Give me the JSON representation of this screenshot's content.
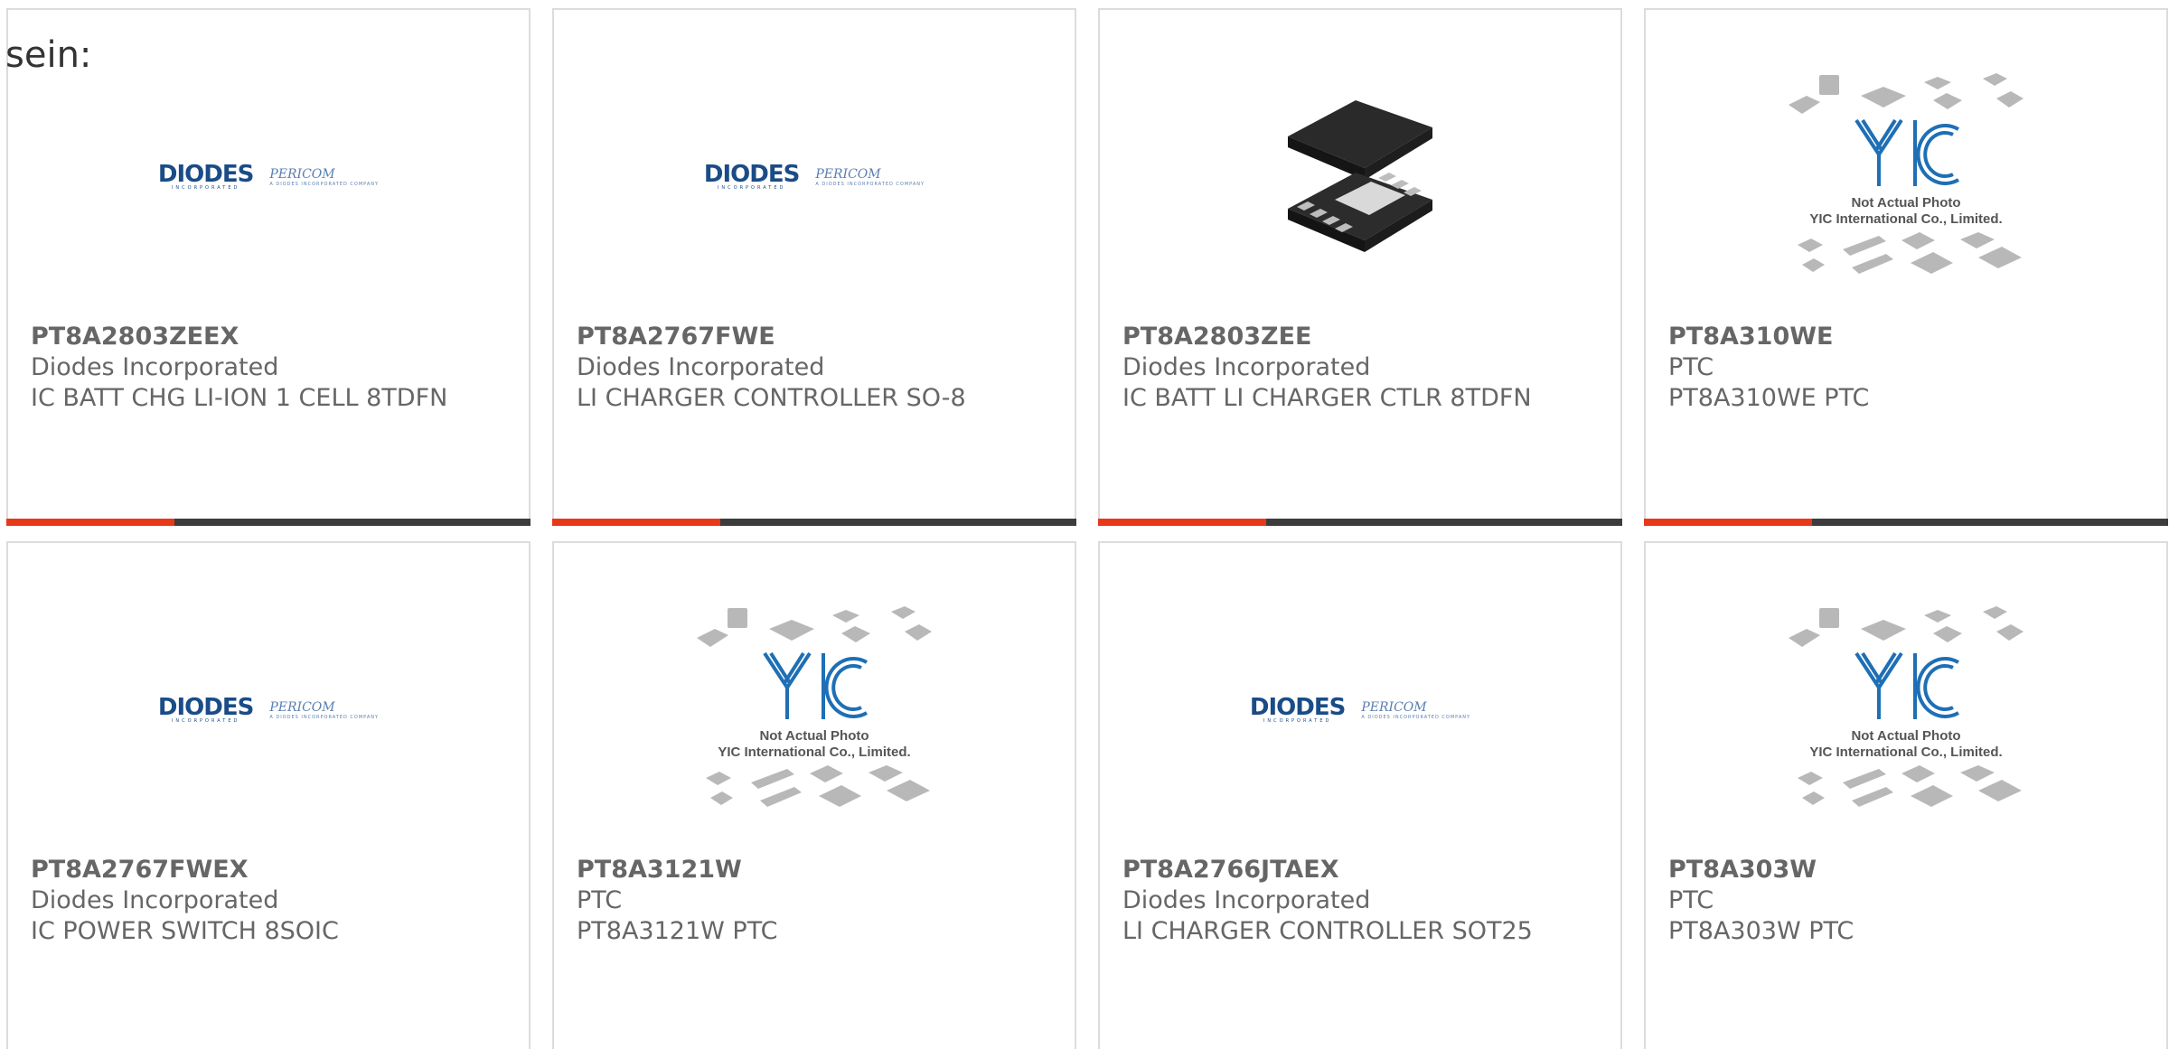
{
  "intro": {
    "text": "sein:"
  },
  "logos": {
    "diodes": "DIODES",
    "diodes_sub": "INCORPORATED",
    "pericom": "PERICOM",
    "pericom_sub": "A DIODES INCORPORATED COMPANY"
  },
  "yic": {
    "line1": "Not Actual Photo",
    "line2": "YIC International Co., Limited."
  },
  "colors": {
    "accent": "#e8381a",
    "bar": "#3c3c3c",
    "text": "#666666",
    "brand_blue": "#1a4c87"
  },
  "products": [
    {
      "part": "PT8A2803ZEEX",
      "manufacturer": "Diodes Incorporated",
      "description": "IC BATT CHG LI-ION 1 CELL 8TDFN",
      "image": "diodes-pericom-logo",
      "progress": 0.32
    },
    {
      "part": "PT8A2767FWE",
      "manufacturer": "Diodes Incorporated",
      "description": "LI CHARGER CONTROLLER SO-8",
      "image": "diodes-pericom-logo",
      "progress": 0.32
    },
    {
      "part": "PT8A2803ZEE",
      "manufacturer": "Diodes Incorporated",
      "description": "IC BATT LI CHARGER CTLR 8TDFN",
      "image": "chip-photo",
      "progress": 0.32
    },
    {
      "part": "PT8A310WE",
      "manufacturer": "PTC",
      "description": "PT8A310WE PTC",
      "image": "yic-placeholder",
      "progress": 0.32
    },
    {
      "part": "PT8A2767FWEX",
      "manufacturer": "Diodes Incorporated",
      "description": "IC POWER SWITCH 8SOIC",
      "image": "diodes-pericom-logo"
    },
    {
      "part": "PT8A3121W",
      "manufacturer": "PTC",
      "description": "PT8A3121W PTC",
      "image": "yic-placeholder"
    },
    {
      "part": "PT8A2766JTAEX",
      "manufacturer": "Diodes Incorporated",
      "description": "LI CHARGER CONTROLLER SOT25",
      "image": "diodes-pericom-logo"
    },
    {
      "part": "PT8A303W",
      "manufacturer": "PTC",
      "description": "PT8A303W PTC",
      "image": "yic-placeholder"
    }
  ]
}
